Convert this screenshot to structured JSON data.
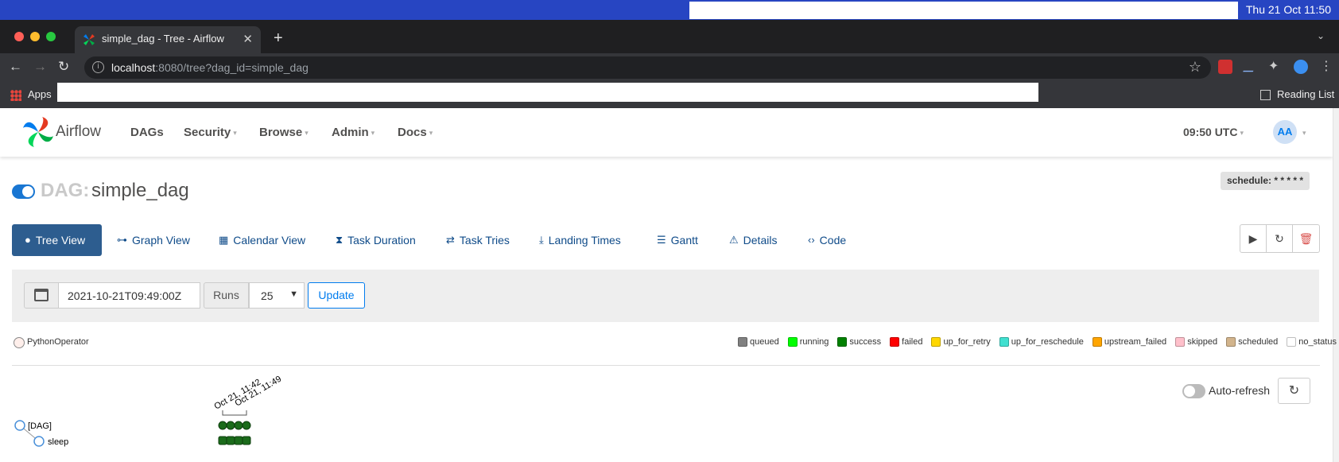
{
  "os": {
    "clock": "Thu 21 Oct  11:50"
  },
  "browser": {
    "tab_title": "simple_dag - Tree - Airflow",
    "url_host": "localhost",
    "url_rest": ":8080/tree?dag_id=simple_dag",
    "bookmarks": {
      "apps": "Apps",
      "reading_list": "Reading List"
    }
  },
  "navbar": {
    "brand": "Airflow",
    "menus": [
      "DAGs",
      "Security",
      "Browse",
      "Admin",
      "Docs"
    ],
    "time": "09:50 UTC",
    "avatar": "AA"
  },
  "dag": {
    "label": "DAG:",
    "name": "simple_dag",
    "schedule": "schedule: * * * * *"
  },
  "views": [
    "Tree View",
    "Graph View",
    "Calendar View",
    "Task Duration",
    "Task Tries",
    "Landing Times",
    "Gantt",
    "Details",
    "Code"
  ],
  "form": {
    "date": "2021-10-21T09:49:00Z",
    "runs_label": "Runs",
    "runs_value": "25",
    "update": "Update"
  },
  "operator": "PythonOperator",
  "legend": [
    {
      "label": "queued",
      "color": "#808080"
    },
    {
      "label": "running",
      "color": "#00ff00"
    },
    {
      "label": "success",
      "color": "#008000"
    },
    {
      "label": "failed",
      "color": "#ff0000"
    },
    {
      "label": "up_for_retry",
      "color": "#ffd700"
    },
    {
      "label": "up_for_reschedule",
      "color": "#40e0d0"
    },
    {
      "label": "upstream_failed",
      "color": "#ffa500"
    },
    {
      "label": "skipped",
      "color": "#ffc0cb"
    },
    {
      "label": "scheduled",
      "color": "#d2b48c"
    },
    {
      "label": "no_status",
      "color": "#ffffff"
    }
  ],
  "auto_refresh": "Auto-refresh",
  "tree": {
    "dag_node": "[DAG]",
    "task_node": "sleep",
    "run_dates": [
      "Oct 21, 11:42",
      "Oct 21, 11:49"
    ],
    "runs": 4,
    "success_color": "#1b6b1b"
  }
}
